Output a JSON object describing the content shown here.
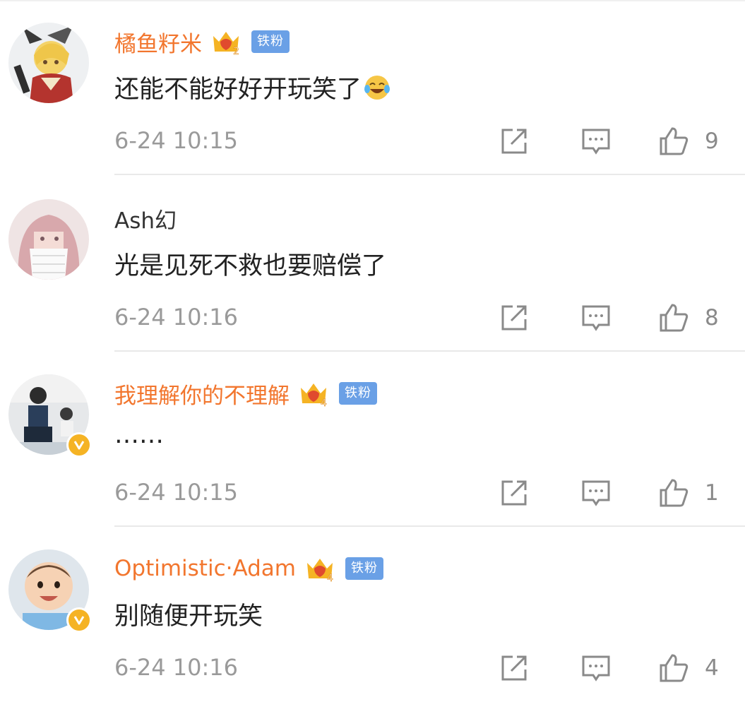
{
  "comments": [
    {
      "username": "橘鱼籽米",
      "vip": true,
      "crown_level": "2",
      "fan_badge": "铁粉",
      "text": "还能不能好好开玩笑了",
      "emoji": "laugh-cry-emoji",
      "time": "6-24 10:15",
      "likes": "9",
      "verified": false,
      "avatar": "anime-character-avatar"
    },
    {
      "username": "Ash幻",
      "vip": false,
      "crown_level": "",
      "fan_badge": "",
      "text": "光是见死不救也要赔偿了",
      "emoji": "",
      "time": "6-24 10:16",
      "likes": "8",
      "verified": false,
      "avatar": "anime-girl-avatar"
    },
    {
      "username": "我理解你的不理解",
      "vip": true,
      "crown_level": "4",
      "fan_badge": "铁粉",
      "text": "……",
      "emoji": "",
      "time": "6-24 10:15",
      "likes": "1",
      "verified": true,
      "avatar": "person-photo-avatar"
    },
    {
      "username": "Optimistic·Adam",
      "vip": true,
      "crown_level": "4",
      "fan_badge": "铁粉",
      "text": "别随便开玩笑",
      "emoji": "",
      "time": "6-24 10:16",
      "likes": "4",
      "verified": true,
      "avatar": "baby-photo-avatar"
    }
  ],
  "icons": {
    "share": "share-icon",
    "reply": "comment-icon",
    "like": "thumbs-up-icon"
  },
  "colors": {
    "vip_name": "#f2762e",
    "fan_badge": "#6aa0e6",
    "verified": "#f5b324",
    "meta_text": "#9a9a9a"
  }
}
